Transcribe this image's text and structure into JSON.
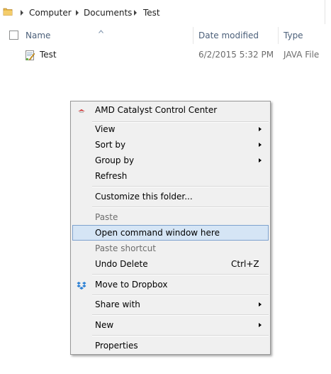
{
  "address_bar": {
    "crumbs": [
      "Computer",
      "Documents",
      "Test"
    ]
  },
  "columns": {
    "name": "Name",
    "date_modified": "Date modified",
    "type": "Type"
  },
  "file": {
    "name": "Test",
    "date": "6/2/2015 5:32 PM",
    "type": "JAVA File",
    "icon": "java-file-icon"
  },
  "context_menu": {
    "items": [
      {
        "label": "AMD Catalyst Control Center",
        "icon": "amd-icon"
      },
      {
        "label": "View",
        "submenu": true
      },
      {
        "label": "Sort by",
        "submenu": true
      },
      {
        "label": "Group by",
        "submenu": true
      },
      {
        "label": "Refresh"
      },
      {
        "label": "Customize this folder..."
      },
      {
        "label": "Paste",
        "disabled": true
      },
      {
        "label": "Open command window here",
        "highlighted": true
      },
      {
        "label": "Paste shortcut",
        "disabled": true
      },
      {
        "label": "Undo Delete",
        "shortcut": "Ctrl+Z"
      },
      {
        "label": "Move to Dropbox",
        "icon": "dropbox-icon"
      },
      {
        "label": "Share with",
        "submenu": true
      },
      {
        "label": "New",
        "submenu": true
      },
      {
        "label": "Properties"
      }
    ]
  },
  "colors": {
    "highlight_bg": "#d5e5f5",
    "highlight_border": "#7da2ce",
    "column_header_text": "#4c607a",
    "menu_bg": "#f0f0f0"
  }
}
